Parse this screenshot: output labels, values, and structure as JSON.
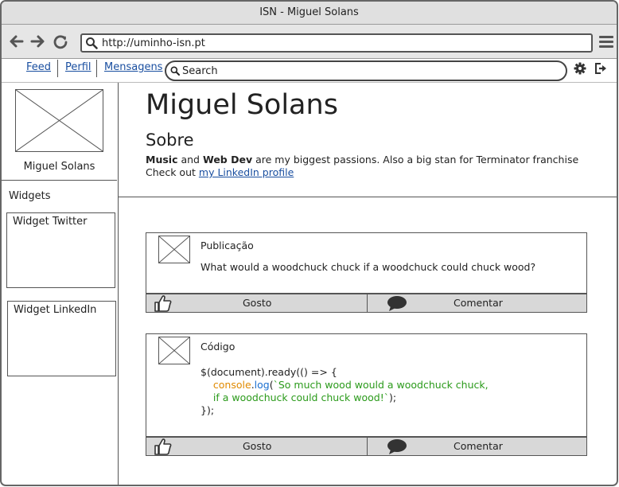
{
  "window": {
    "title": "ISN - Miguel Solans"
  },
  "browser": {
    "url": "http://uminho-isn.pt",
    "icons": [
      "back-arrow-icon",
      "forward-arrow-icon",
      "reload-icon",
      "search-icon",
      "hamburger-menu-icon"
    ]
  },
  "toolbar": {
    "nav": [
      {
        "label": "Feed"
      },
      {
        "label": "Perfil"
      },
      {
        "label": "Mensagens"
      }
    ],
    "search_placeholder": "Search",
    "icons": [
      "gear-icon",
      "logout-icon"
    ]
  },
  "sidebar": {
    "name": "Miguel Solans",
    "widgets_title": "Widgets",
    "widgets": [
      {
        "label": "Widget Twitter"
      },
      {
        "label": "Widget LinkedIn"
      }
    ]
  },
  "profile": {
    "name": "Miguel Solans",
    "about_title": "Sobre",
    "bio": {
      "music": "Music",
      "and": "and",
      "webdev": "Web Dev",
      "rest": "are my biggest passions. Also a big stan for Terminator franchise",
      "checkout": "Check out",
      "link": "my LinkedIn profile"
    }
  },
  "posts": [
    {
      "title": "Publicação",
      "body": "What would a woodchuck chuck if a woodchuck could chuck wood?",
      "like_label": "Gosto",
      "comment_label": "Comentar"
    },
    {
      "title": "Código",
      "code": {
        "line1": "$(document).ready(() => {",
        "obj": "console",
        "dot": ".",
        "fn": "log",
        "paren_open": "(",
        "str1": "`So much wood would a woodchuck chuck,",
        "str2": "if a woodchuck could chuck wood!`",
        "end2": ");",
        "line4": "});"
      },
      "like_label": "Gosto",
      "comment_label": "Comentar"
    }
  ],
  "colors": {
    "link": "#1a4fa0",
    "code_object": "#e08a00",
    "code_function": "#1a6fd0",
    "code_string": "#2a9a1a",
    "action_bar": "#d8d8d8"
  }
}
